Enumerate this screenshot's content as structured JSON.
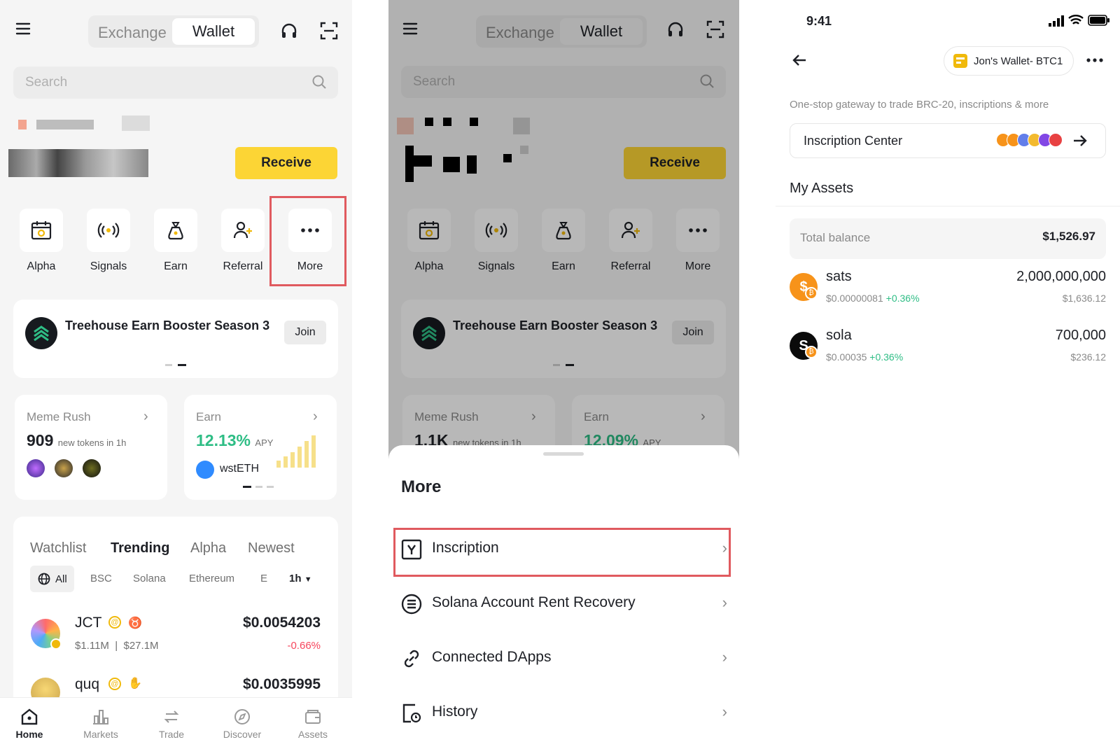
{
  "colors": {
    "accent": "#fcd535",
    "highlight": "#e05a5f",
    "up": "#2ebd85",
    "down": "#f6465d"
  },
  "header": {
    "tab_exchange": "Exchange",
    "tab_wallet": "Wallet"
  },
  "search": {
    "placeholder": "Search"
  },
  "receive_label": "Receive",
  "quick_actions": [
    {
      "label": "Alpha",
      "icon": "calendar-alpha-icon"
    },
    {
      "label": "Signals",
      "icon": "signal-broadcast-icon"
    },
    {
      "label": "Earn",
      "icon": "money-bag-icon"
    },
    {
      "label": "Referral",
      "icon": "add-user-icon"
    },
    {
      "label": "More",
      "icon": "more-dots-icon"
    }
  ],
  "banner": {
    "title": "Treehouse Earn Booster Season 3",
    "join": "Join"
  },
  "meme_rush": {
    "title": "Meme Rush",
    "screen1_count": "909",
    "screen2_count": "1.1K",
    "suffix": "new tokens in 1h"
  },
  "earn_card": {
    "title": "Earn",
    "screen1_apy": "12.13%",
    "screen2_apy": "12.09%",
    "apy_label": "APY",
    "token": "wstETH"
  },
  "list_tabs": [
    "Watchlist",
    "Trending",
    "Alpha",
    "Newest"
  ],
  "chain_filters": {
    "all": "All",
    "bsc": "BSC",
    "solana": "Solana",
    "ethereum": "Ethereum",
    "truncated": "E",
    "interval": "1h"
  },
  "tokens": [
    {
      "name": "JCT",
      "mcap": "$1.11M",
      "vol": "$27.1M",
      "price": "$0.0054203",
      "change": "-0.66%"
    },
    {
      "name": "quq",
      "price": "$0.0035995"
    }
  ],
  "bottom_nav": [
    "Home",
    "Markets",
    "Trade",
    "Discover",
    "Assets"
  ],
  "more_sheet": {
    "title": "More",
    "items": [
      {
        "label": "Inscription",
        "icon": "inscription-icon"
      },
      {
        "label": "Solana Account Rent Recovery",
        "icon": "solana-circle-icon"
      },
      {
        "label": "Connected DApps",
        "icon": "link-icon"
      },
      {
        "label": "History",
        "icon": "history-document-icon"
      }
    ]
  },
  "inscription_page": {
    "time": "9:41",
    "wallet_name": "Jon's Wallet- BTC1",
    "description": "One-stop gateway to trade BRC-20, inscriptions & more",
    "center_label": "Inscription Center",
    "my_assets": "My Assets",
    "total_balance_label": "Total balance",
    "total_balance": "$1,526.97",
    "assets": [
      {
        "name": "sats",
        "price": "$0.00000081",
        "change": "+0.36%",
        "amount": "2,000,000,000",
        "usd": "$1,636.12"
      },
      {
        "name": "sola",
        "price": "$0.00035",
        "change": "+0.36%",
        "amount": "700,000",
        "usd": "$236.12"
      }
    ]
  }
}
